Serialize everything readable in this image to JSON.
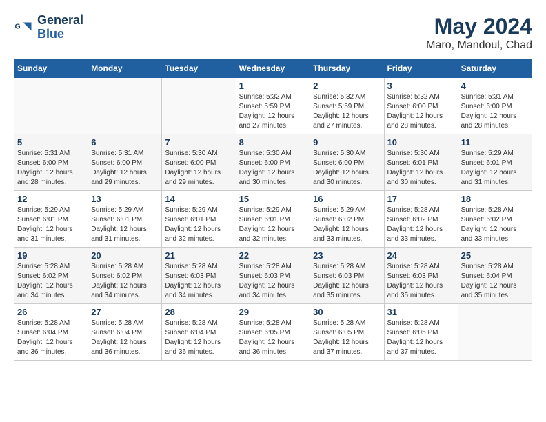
{
  "header": {
    "logo_general": "General",
    "logo_blue": "Blue",
    "month_title": "May 2024",
    "location": "Maro, Mandoul, Chad"
  },
  "calendar": {
    "days_of_week": [
      "Sunday",
      "Monday",
      "Tuesday",
      "Wednesday",
      "Thursday",
      "Friday",
      "Saturday"
    ],
    "weeks": [
      [
        {
          "day": "",
          "info": ""
        },
        {
          "day": "",
          "info": ""
        },
        {
          "day": "",
          "info": ""
        },
        {
          "day": "1",
          "info": "Sunrise: 5:32 AM\nSunset: 5:59 PM\nDaylight: 12 hours and 27 minutes."
        },
        {
          "day": "2",
          "info": "Sunrise: 5:32 AM\nSunset: 5:59 PM\nDaylight: 12 hours and 27 minutes."
        },
        {
          "day": "3",
          "info": "Sunrise: 5:32 AM\nSunset: 6:00 PM\nDaylight: 12 hours and 28 minutes."
        },
        {
          "day": "4",
          "info": "Sunrise: 5:31 AM\nSunset: 6:00 PM\nDaylight: 12 hours and 28 minutes."
        }
      ],
      [
        {
          "day": "5",
          "info": "Sunrise: 5:31 AM\nSunset: 6:00 PM\nDaylight: 12 hours and 28 minutes."
        },
        {
          "day": "6",
          "info": "Sunrise: 5:31 AM\nSunset: 6:00 PM\nDaylight: 12 hours and 29 minutes."
        },
        {
          "day": "7",
          "info": "Sunrise: 5:30 AM\nSunset: 6:00 PM\nDaylight: 12 hours and 29 minutes."
        },
        {
          "day": "8",
          "info": "Sunrise: 5:30 AM\nSunset: 6:00 PM\nDaylight: 12 hours and 30 minutes."
        },
        {
          "day": "9",
          "info": "Sunrise: 5:30 AM\nSunset: 6:00 PM\nDaylight: 12 hours and 30 minutes."
        },
        {
          "day": "10",
          "info": "Sunrise: 5:30 AM\nSunset: 6:01 PM\nDaylight: 12 hours and 30 minutes."
        },
        {
          "day": "11",
          "info": "Sunrise: 5:29 AM\nSunset: 6:01 PM\nDaylight: 12 hours and 31 minutes."
        }
      ],
      [
        {
          "day": "12",
          "info": "Sunrise: 5:29 AM\nSunset: 6:01 PM\nDaylight: 12 hours and 31 minutes."
        },
        {
          "day": "13",
          "info": "Sunrise: 5:29 AM\nSunset: 6:01 PM\nDaylight: 12 hours and 31 minutes."
        },
        {
          "day": "14",
          "info": "Sunrise: 5:29 AM\nSunset: 6:01 PM\nDaylight: 12 hours and 32 minutes."
        },
        {
          "day": "15",
          "info": "Sunrise: 5:29 AM\nSunset: 6:01 PM\nDaylight: 12 hours and 32 minutes."
        },
        {
          "day": "16",
          "info": "Sunrise: 5:29 AM\nSunset: 6:02 PM\nDaylight: 12 hours and 33 minutes."
        },
        {
          "day": "17",
          "info": "Sunrise: 5:28 AM\nSunset: 6:02 PM\nDaylight: 12 hours and 33 minutes."
        },
        {
          "day": "18",
          "info": "Sunrise: 5:28 AM\nSunset: 6:02 PM\nDaylight: 12 hours and 33 minutes."
        }
      ],
      [
        {
          "day": "19",
          "info": "Sunrise: 5:28 AM\nSunset: 6:02 PM\nDaylight: 12 hours and 34 minutes."
        },
        {
          "day": "20",
          "info": "Sunrise: 5:28 AM\nSunset: 6:02 PM\nDaylight: 12 hours and 34 minutes."
        },
        {
          "day": "21",
          "info": "Sunrise: 5:28 AM\nSunset: 6:03 PM\nDaylight: 12 hours and 34 minutes."
        },
        {
          "day": "22",
          "info": "Sunrise: 5:28 AM\nSunset: 6:03 PM\nDaylight: 12 hours and 34 minutes."
        },
        {
          "day": "23",
          "info": "Sunrise: 5:28 AM\nSunset: 6:03 PM\nDaylight: 12 hours and 35 minutes."
        },
        {
          "day": "24",
          "info": "Sunrise: 5:28 AM\nSunset: 6:03 PM\nDaylight: 12 hours and 35 minutes."
        },
        {
          "day": "25",
          "info": "Sunrise: 5:28 AM\nSunset: 6:04 PM\nDaylight: 12 hours and 35 minutes."
        }
      ],
      [
        {
          "day": "26",
          "info": "Sunrise: 5:28 AM\nSunset: 6:04 PM\nDaylight: 12 hours and 36 minutes."
        },
        {
          "day": "27",
          "info": "Sunrise: 5:28 AM\nSunset: 6:04 PM\nDaylight: 12 hours and 36 minutes."
        },
        {
          "day": "28",
          "info": "Sunrise: 5:28 AM\nSunset: 6:04 PM\nDaylight: 12 hours and 36 minutes."
        },
        {
          "day": "29",
          "info": "Sunrise: 5:28 AM\nSunset: 6:05 PM\nDaylight: 12 hours and 36 minutes."
        },
        {
          "day": "30",
          "info": "Sunrise: 5:28 AM\nSunset: 6:05 PM\nDaylight: 12 hours and 37 minutes."
        },
        {
          "day": "31",
          "info": "Sunrise: 5:28 AM\nSunset: 6:05 PM\nDaylight: 12 hours and 37 minutes."
        },
        {
          "day": "",
          "info": ""
        }
      ]
    ]
  }
}
